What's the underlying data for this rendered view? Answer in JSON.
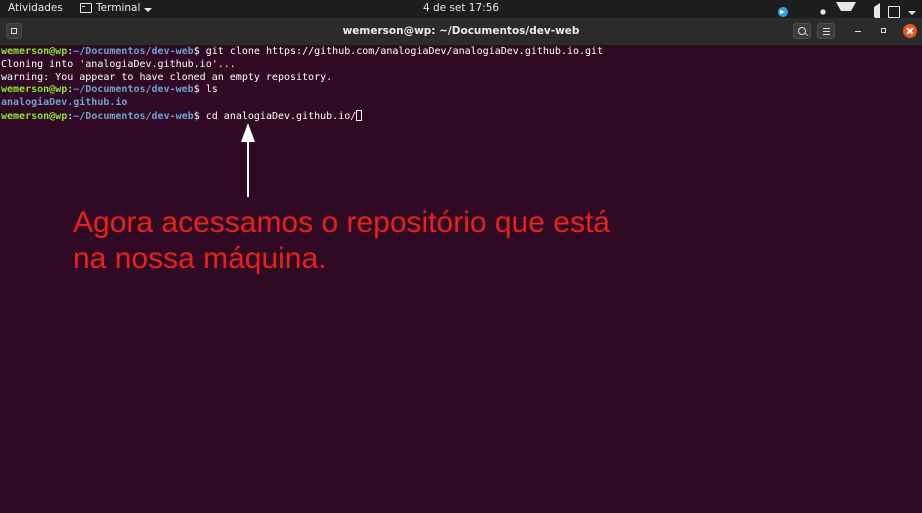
{
  "topbar": {
    "activities": "Atividades",
    "app_name": "Terminal",
    "clock": "4 de set  17:56",
    "tray_icons": [
      "telegram-icon",
      "brightness-icon",
      "wifi-icon",
      "volume-icon",
      "battery-icon",
      "system-menu-caret-icon"
    ]
  },
  "window": {
    "title": "wemerson@wp: ~/Documentos/dev-web"
  },
  "terminal": {
    "prompt_user": "wemerson@wp",
    "prompt_sep": ":",
    "prompt_path": "~/Documentos/dev-web",
    "prompt_symbol": "$",
    "lines": [
      {
        "type": "prompt",
        "command": " git clone https://github.com/analogiaDev/analogiaDev.github.io.git"
      },
      {
        "type": "output",
        "text": "Cloning into 'analogiaDev.github.io'..."
      },
      {
        "type": "output",
        "text": "warning: You appear to have cloned an empty repository."
      },
      {
        "type": "prompt",
        "command": " ls"
      },
      {
        "type": "dir",
        "text": "analogiaDev.github.io"
      },
      {
        "type": "prompt",
        "command": " cd analogiaDev.github.io/",
        "cursor": true
      }
    ]
  },
  "annotation": {
    "line1": "Agora acessamos o repositório que está",
    "line2": "na nossa máquina.",
    "color": "#e8211c"
  },
  "colors": {
    "terminal_bg": "#300a24",
    "prompt_user": "#8ae234",
    "prompt_path": "#729fcf",
    "close_button": "#e95420"
  }
}
